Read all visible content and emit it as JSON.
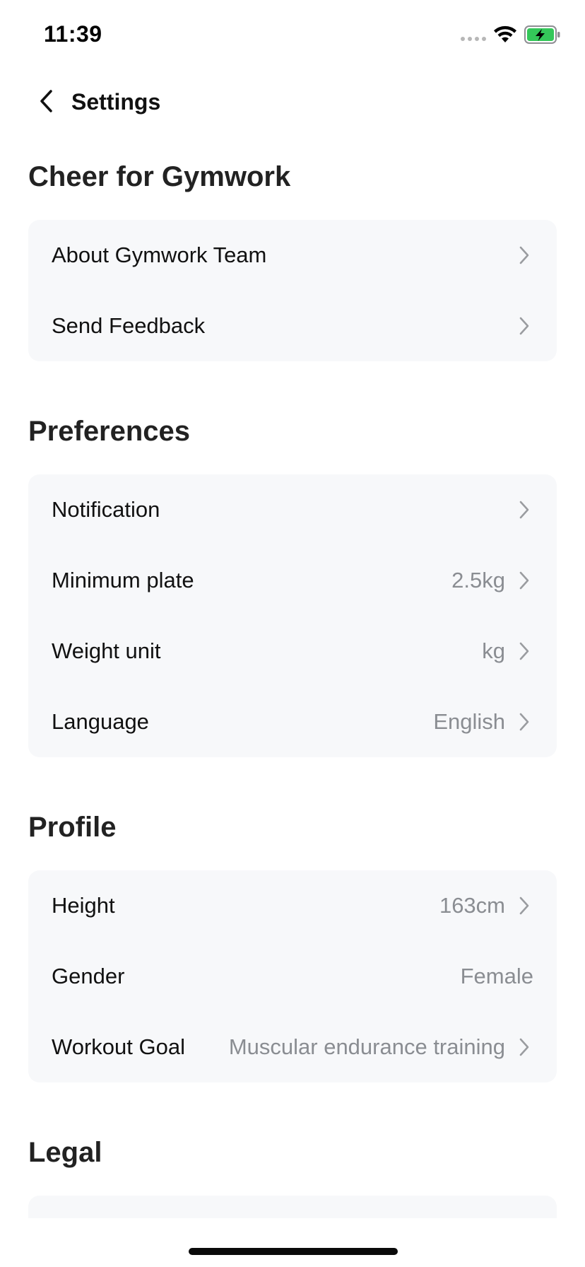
{
  "status_bar": {
    "time": "11:39",
    "wifi_icon": "wifi-icon",
    "battery_icon": "battery-charging-icon",
    "battery_color": "#34c759"
  },
  "nav": {
    "back_icon": "chevron-left-icon",
    "title": "Settings"
  },
  "sections": {
    "cheer": {
      "title": "Cheer for Gymwork",
      "items": [
        {
          "label": "About Gymwork Team",
          "value": ""
        },
        {
          "label": "Send Feedback",
          "value": ""
        }
      ]
    },
    "preferences": {
      "title": "Preferences",
      "items": [
        {
          "label": "Notification",
          "value": ""
        },
        {
          "label": "Minimum plate",
          "value": "2.5kg"
        },
        {
          "label": "Weight unit",
          "value": "kg"
        },
        {
          "label": "Language",
          "value": "English"
        }
      ]
    },
    "profile": {
      "title": "Profile",
      "items": [
        {
          "label": "Height",
          "value": "163cm"
        },
        {
          "label": "Gender",
          "value": "Female"
        },
        {
          "label": "Workout Goal",
          "value": "Muscular endurance training"
        }
      ]
    },
    "legal": {
      "title": "Legal"
    }
  },
  "colors": {
    "card_background": "#f7f8fa",
    "value_text": "#8a8d92",
    "chevron": "#9a9ca0"
  }
}
